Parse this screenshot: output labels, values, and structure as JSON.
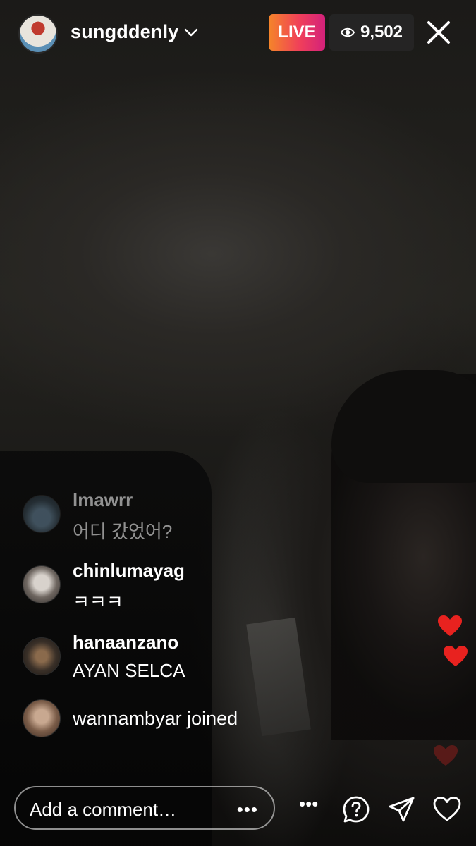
{
  "header": {
    "username": "sungddenly",
    "live_label": "LIVE",
    "viewer_count": "9,502"
  },
  "comments": [
    {
      "username": "lmawrr",
      "text": "어디 갔었어?",
      "faded": true
    },
    {
      "username": "chinlumayag",
      "text": "ㅋㅋㅋ"
    },
    {
      "username": "hanaanzano",
      "text": "AYAN SELCA"
    }
  ],
  "join_notice": {
    "text": "wannambyar joined"
  },
  "comment_input": {
    "placeholder": "Add a comment…"
  },
  "colors": {
    "live_gradient_start": "#f58529",
    "live_gradient_end": "#d3217b",
    "heart": "#e8221f"
  },
  "icons": [
    "chevron-down-icon",
    "eye-icon",
    "close-icon",
    "more-icon",
    "question-icon",
    "send-icon",
    "heart-icon"
  ]
}
